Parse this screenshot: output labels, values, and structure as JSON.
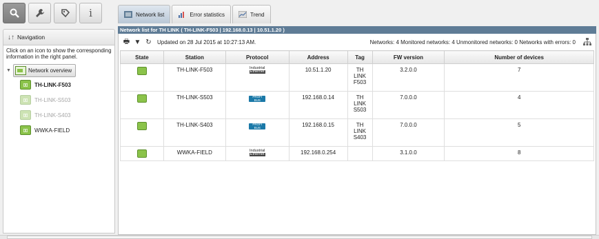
{
  "toolbar_left": {
    "buttons": [
      {
        "icon": "search-icon",
        "active": true
      },
      {
        "icon": "wrench-icon",
        "active": false
      },
      {
        "icon": "refresh-tag-icon",
        "active": false
      },
      {
        "icon": "info-icon",
        "active": false,
        "glyph": "i"
      }
    ]
  },
  "navigation": {
    "title": "Navigation",
    "hint": "Click on an icon to show the corresponding information in the right panel.",
    "root_label": "Network overview",
    "items": [
      {
        "label": "TH-LINK-F503",
        "selected": true,
        "enabled": true
      },
      {
        "label": "TH-LINK-S503",
        "selected": false,
        "enabled": false
      },
      {
        "label": "TH-LINK-S403",
        "selected": false,
        "enabled": false
      },
      {
        "label": "WWKA-FIELD",
        "selected": false,
        "enabled": true
      }
    ]
  },
  "tabs": [
    {
      "label": "Network list",
      "active": true
    },
    {
      "label": "Error statistics",
      "active": false
    },
    {
      "label": "Trend",
      "active": false
    }
  ],
  "panel": {
    "title": "Network list for TH LINK ( TH-LINK-F503 | 192.168.0.13 | 10.51.1.20 )",
    "updated": "Updated on 28 Jul 2015 at 10:27:13 AM.",
    "summary": "Networks: 4 Monitored networks: 4 Unmonitored networks: 0 Networks with errors: 0"
  },
  "table": {
    "headers": [
      "State",
      "Station",
      "Protocol",
      "Address",
      "Tag",
      "FW version",
      "Number of devices"
    ],
    "rows": [
      {
        "station": "TH-LINK-F503",
        "protocol": "Industrial Ethernet",
        "address": "10.51.1.20",
        "tag": [
          "TH",
          "LINK",
          "F503"
        ],
        "fw": "3.2.0.0",
        "devices": "7"
      },
      {
        "station": "TH-LINK-S503",
        "protocol": "PROFIBUS",
        "address": "192.168.0.14",
        "tag": [
          "TH",
          "LINK",
          "S503"
        ],
        "fw": "7.0.0.0",
        "devices": "4"
      },
      {
        "station": "TH-LINK-S403",
        "protocol": "PROFIBUS",
        "address": "192.168.0.15",
        "tag": [
          "TH",
          "LINK",
          "S403"
        ],
        "fw": "7.0.0.0",
        "devices": "5"
      },
      {
        "station": "WWKA-FIELD",
        "protocol": "Industrial Ethernet",
        "address": "192.168.0.254",
        "tag": [
          "",
          "",
          ""
        ],
        "fw": "3.1.0.0",
        "devices": "8"
      }
    ],
    "protocol_badges": {
      "ie_line1": "Industrial",
      "ie_line2": "Ethernet",
      "pb_line1": "PROFI",
      "pb_line2": "BUS"
    }
  },
  "colors": {
    "title_bar": "#5f7c96",
    "device_green": "#8bc34a",
    "profibus_blue": "#1b79a8"
  }
}
